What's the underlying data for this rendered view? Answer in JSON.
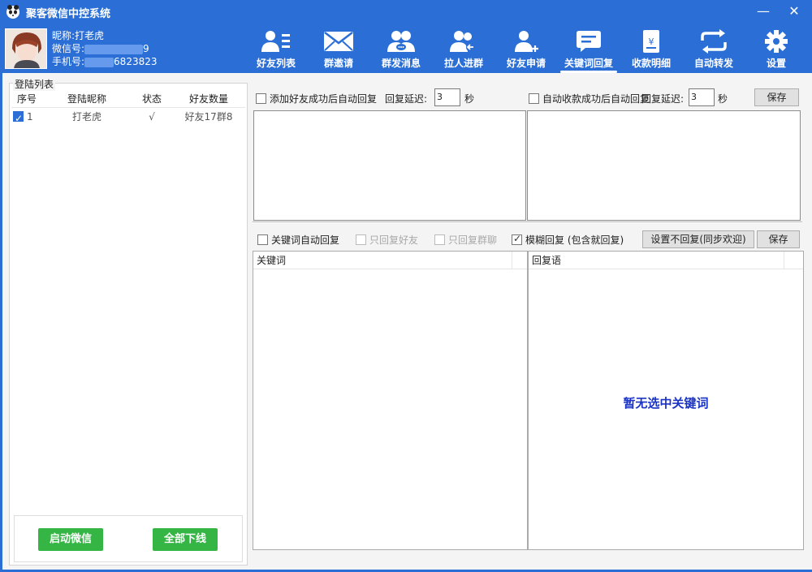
{
  "window": {
    "title": "聚客微信中控系统",
    "min_glyph": "—",
    "close_glyph": "✕"
  },
  "profile": {
    "nickname_label": "昵称:",
    "nickname": "打老虎",
    "wechat_label": "微信号:",
    "wechat_visible_tail": "9",
    "phone_label": "手机号:",
    "phone_visible_tail": "6823823"
  },
  "toolbar": [
    {
      "label": "好友列表",
      "icon": "friends-list-icon"
    },
    {
      "label": "群邀请",
      "icon": "group-invite-icon"
    },
    {
      "label": "群发消息",
      "icon": "group-message-icon"
    },
    {
      "label": "拉人进群",
      "icon": "pull-into-group-icon"
    },
    {
      "label": "好友申请",
      "icon": "friend-request-icon"
    },
    {
      "label": "关键词回复",
      "icon": "keyword-reply-icon",
      "active": true
    },
    {
      "label": "收款明细",
      "icon": "payment-details-icon"
    },
    {
      "label": "自动转发",
      "icon": "auto-forward-icon"
    },
    {
      "label": "设置",
      "icon": "settings-icon"
    }
  ],
  "login_list": {
    "legend": "登陆列表",
    "columns": [
      "序号",
      "登陆昵称",
      "状态",
      "好友数量"
    ],
    "rows": [
      {
        "checked": true,
        "index": "1",
        "nickname": "打老虎",
        "status": "√",
        "friends": "好友17群8"
      }
    ],
    "start_button": "启动微信",
    "offline_button": "全部下线"
  },
  "auto_reply": {
    "friend_option": "添加好友成功后自动回复",
    "friend_checked": false,
    "delay_label": "回复延迟:",
    "friend_delay": "3",
    "seconds": "秒",
    "payment_option": "自动收款成功后自动回复",
    "payment_checked": false,
    "payment_delay": "3",
    "save": "保存"
  },
  "keyword": {
    "auto_reply": "关键词自动回复",
    "auto_reply_checked": false,
    "only_friends": "只回复好友",
    "only_groups": "只回复群聊",
    "fuzzy": "模糊回复 (包含就回复)",
    "fuzzy_checked": true,
    "no_reply_button": "设置不回复(同步欢迎)",
    "save": "保存",
    "col_keyword": "关键词",
    "col_reply": "回复语",
    "empty_text": "暂无选中关键词"
  },
  "colors": {
    "brand_blue": "#2b6fd6",
    "green": "#35b544",
    "empty_text": "#1a33c4"
  }
}
